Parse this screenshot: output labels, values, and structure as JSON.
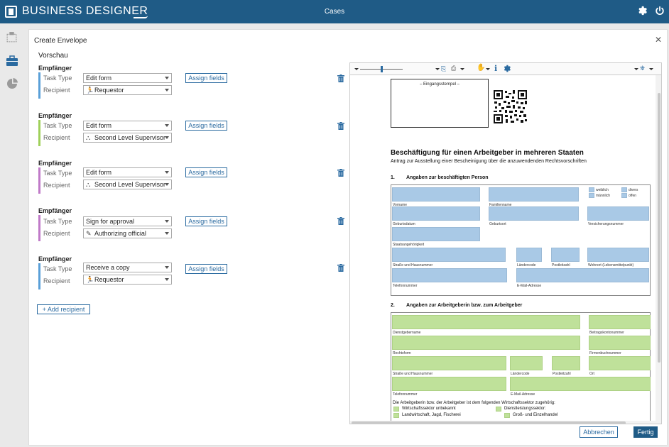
{
  "app": {
    "brand": "BUSINESS DESIGNER",
    "window_title": "Cases"
  },
  "dialog": {
    "title": "Create Envelope",
    "preview_heading": "Vorschau",
    "recipient_heading": "Empfänger",
    "task_type_label": "Task Type",
    "recipient_label": "Recipient",
    "assign_label": "Assign fields",
    "add_recipient": "+ Add recipient",
    "cancel": "Abbrechen",
    "done": "Fertig"
  },
  "recipients": [
    {
      "task_type": "Edit form",
      "recipient": "Requestor",
      "recipient_icon": "runner-icon",
      "color": "#5aa0d8"
    },
    {
      "task_type": "Edit form",
      "recipient": "Second Level Supervisor",
      "recipient_icon": "org-chart-icon",
      "color": "#9fd05a"
    },
    {
      "task_type": "Edit form",
      "recipient": "Second Level Supervisor",
      "recipient_icon": "org-chart-icon",
      "color": "#c07ac8"
    },
    {
      "task_type": "Sign for approval",
      "recipient": "Authorizing official",
      "recipient_icon": "pen-icon",
      "color": "#c07ac8"
    },
    {
      "task_type": "Receive a copy",
      "recipient": "Requestor",
      "recipient_icon": "runner-icon",
      "color": "#5aa0d8"
    }
  ],
  "document": {
    "stamp_label": "– Eingangsstempel –",
    "title": "Beschäftigung für einen Arbeitgeber in mehreren Staaten",
    "subtitle": "Antrag zur Ausstellung einer Bescheinigung über die anzuwendenden Rechtsvorschriften",
    "section1_num": "1.",
    "section1_title": "Angaben zur beschäftigten Person",
    "section2_num": "2.",
    "section2_title": "Angaben zur Arbeitgeberin bzw. zum Arbeitgeber",
    "gender": {
      "female": "weiblich",
      "male": "männlich",
      "diverse": "divers",
      "open": "offen"
    },
    "s1_labels": {
      "vorname": "Vorname",
      "familienname": "Familienname",
      "geburtsdatum": "Geburtsdatum",
      "geburtsort": "Geburtsort",
      "versicherungsnummer": "Versicherungsnummer",
      "staatsangehoerigkeit": "Staatsangehörigkeit",
      "strasse": "Straße und Hausnummer",
      "laendercode": "Ländercode",
      "plz": "Postleitzahl",
      "wohnort": "Wohnort (Lebensmittelpunkt)",
      "telefon": "Telefonnummer",
      "email": "E-Mail-Adresse"
    },
    "s2_labels": {
      "dienstgebername": "Dienstgebername",
      "beitragskontonummer": "Beitragskontonummer",
      "rechtsform": "Rechtsform",
      "firmenbuchnummer": "Firmenbuchnummer",
      "strasse": "Straße und Hausnummer",
      "laendercode": "Ländercode",
      "plz": "Postleitzahl",
      "ort": "Ort",
      "telefon": "Telefonnummer",
      "email": "E-Mail-Adresse"
    },
    "sector_question": "Die Arbeitgeberin bzw. der Arbeitgeber ist dem folgenden Wirtschaftssektor zugehörig:",
    "sector_options": {
      "unknown": "Wirtschaftssektor unbekannt",
      "agri": "Landwirtschaft, Jagd, Fischerei",
      "services": "Dienstleistungssektor:",
      "retail": "Groß- und Einzelhandel"
    }
  }
}
